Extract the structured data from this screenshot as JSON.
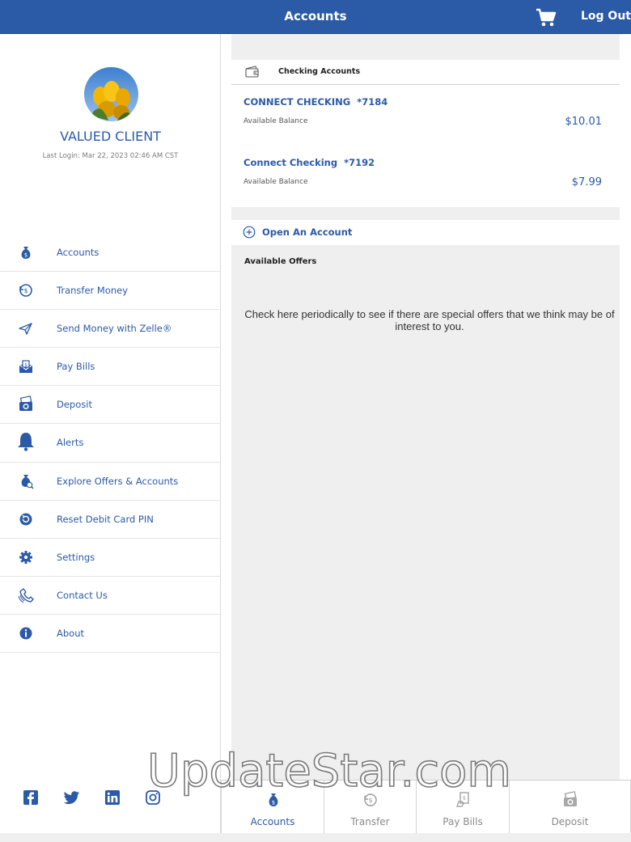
{
  "header": {
    "title": "Accounts",
    "logout_label": "Log Out",
    "cart_icon": "shopping-cart-icon"
  },
  "colors": {
    "brand": "#2b5aa7",
    "background": "#efefef"
  },
  "profile": {
    "name": "VALUED CLIENT",
    "last_login": "Last Login: Mar 22, 2023 02:46 AM CST"
  },
  "sidebar": {
    "items": [
      {
        "label": "Accounts",
        "icon": "money-bag-icon"
      },
      {
        "label": "Transfer Money",
        "icon": "transfer-icon"
      },
      {
        "label": "Send Money with Zelle®",
        "icon": "paper-plane-icon"
      },
      {
        "label": "Pay Bills",
        "icon": "envelope-bill-icon"
      },
      {
        "label": "Deposit",
        "icon": "camera-check-icon"
      },
      {
        "label": "Alerts",
        "icon": "bell-icon"
      },
      {
        "label": "Explore Offers & Accounts",
        "icon": "money-bag-offers-icon"
      },
      {
        "label": "Reset Debit Card PIN",
        "icon": "reset-icon"
      },
      {
        "label": "Settings",
        "icon": "gear-icon"
      },
      {
        "label": "Contact Us",
        "icon": "phone-icon"
      },
      {
        "label": "About",
        "icon": "info-icon"
      }
    ],
    "social": [
      "facebook-icon",
      "twitter-icon",
      "linkedin-icon",
      "instagram-icon"
    ]
  },
  "main": {
    "checking": {
      "title": "Checking Accounts",
      "accounts": [
        {
          "name": "CONNECT CHECKING",
          "number": "*7184",
          "sub_label": "Available Balance",
          "balance": "$10.01"
        },
        {
          "name": "Connect Checking",
          "number": "*7192",
          "sub_label": "Available Balance",
          "balance": "$7.99"
        }
      ]
    },
    "open_account_label": "Open An Account",
    "offers": {
      "title": "Available Offers",
      "text": "Check here periodically to see if there are special offers that we think may be of interest to you."
    }
  },
  "tabs": [
    {
      "label": "Accounts",
      "active": true,
      "icon": "money-bag-icon"
    },
    {
      "label": "Transfer",
      "active": false,
      "icon": "transfer-icon"
    },
    {
      "label": "Pay Bills",
      "active": false,
      "icon": "bill-icon"
    },
    {
      "label": "Deposit",
      "active": false,
      "icon": "camera-check-icon"
    }
  ],
  "watermark": "UpdateStar.com"
}
